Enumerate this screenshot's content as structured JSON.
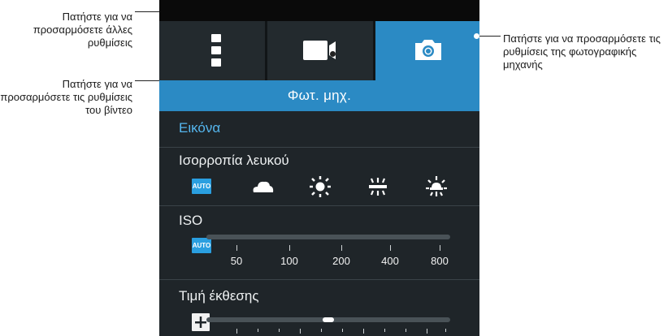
{
  "callouts": {
    "more_settings": "Πατήστε για να προσαρμόσετε άλλες ρυθμίσεις",
    "video_settings": "Πατήστε για να προσαρμόσετε τις ρυθμίσεις του βίντεο",
    "camera_settings": "Πατήστε για να προσαρμόσετε τις ρυθμίσεις της φωτογραφικής μηχανής"
  },
  "tabs": [
    {
      "icon": "vertical-dots-icon",
      "active": false
    },
    {
      "icon": "video-camera-icon",
      "active": false
    },
    {
      "icon": "camera-icon",
      "active": true
    }
  ],
  "header": {
    "title": "Φωτ. μηχ."
  },
  "section": {
    "title": "Εικόνα"
  },
  "white_balance": {
    "label": "Ισορροπία λευκού",
    "auto_label": "AUTO",
    "options": [
      "auto-icon",
      "cloud-icon",
      "sun-icon",
      "fluorescent-icon",
      "incandescent-icon"
    ],
    "selected": "AUTO"
  },
  "iso": {
    "label": "ISO",
    "auto_label": "AUTO",
    "ticks": [
      "50",
      "100",
      "200",
      "400",
      "800"
    ],
    "selected": "AUTO"
  },
  "exposure": {
    "label": "Τιμή έκθεσης",
    "value_fraction": 0.5
  },
  "colors": {
    "accent": "#2b8ac4",
    "section_text": "#55b6ee",
    "panel_bg": "#1f2529",
    "auto_badge": "#2a9fe0"
  }
}
